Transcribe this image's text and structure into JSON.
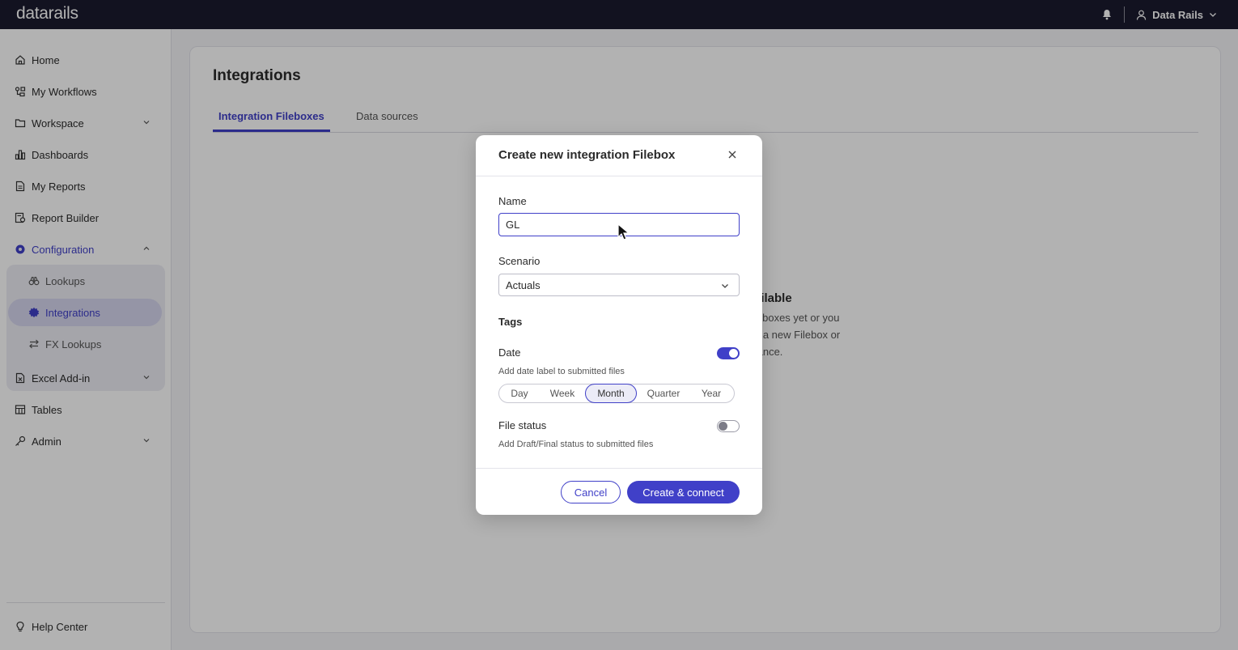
{
  "app": {
    "logo": "datarails"
  },
  "topbar": {
    "user_name": "Data Rails"
  },
  "sidebar": {
    "items": [
      {
        "label": "Home"
      },
      {
        "label": "My Workflows"
      },
      {
        "label": "Workspace"
      },
      {
        "label": "Dashboards"
      },
      {
        "label": "My Reports"
      },
      {
        "label": "Report Builder"
      },
      {
        "label": "Configuration"
      },
      {
        "label": "Excel Add-in"
      },
      {
        "label": "Tables"
      },
      {
        "label": "Admin"
      }
    ],
    "config_subitems": [
      {
        "label": "Lookups"
      },
      {
        "label": "Integrations"
      },
      {
        "label": "FX Lookups"
      }
    ],
    "help": "Help Center"
  },
  "main": {
    "title": "Integrations",
    "tabs": [
      {
        "label": "Integration Fileboxes"
      },
      {
        "label": "Data sources"
      }
    ],
    "empty_state": {
      "title_visible": "ailable",
      "line1": "leboxes yet or you",
      "line2": "e a new Filebox or",
      "line3": "tance."
    }
  },
  "modal": {
    "title": "Create new integration Filebox",
    "name_label": "Name",
    "name_value": "GL",
    "scenario_label": "Scenario",
    "scenario_value": "Actuals",
    "tags_label": "Tags",
    "date_label": "Date",
    "date_enabled": true,
    "date_hint": "Add date label to submitted files",
    "date_options": [
      "Day",
      "Week",
      "Month",
      "Quarter",
      "Year"
    ],
    "date_selected": "Month",
    "file_status_label": "File status",
    "file_status_enabled": false,
    "file_status_hint": "Add Draft/Final status to submitted files",
    "cancel_label": "Cancel",
    "submit_label": "Create & connect"
  },
  "colors": {
    "accent": "#4040c8",
    "topbar": "#1a1a2e"
  }
}
